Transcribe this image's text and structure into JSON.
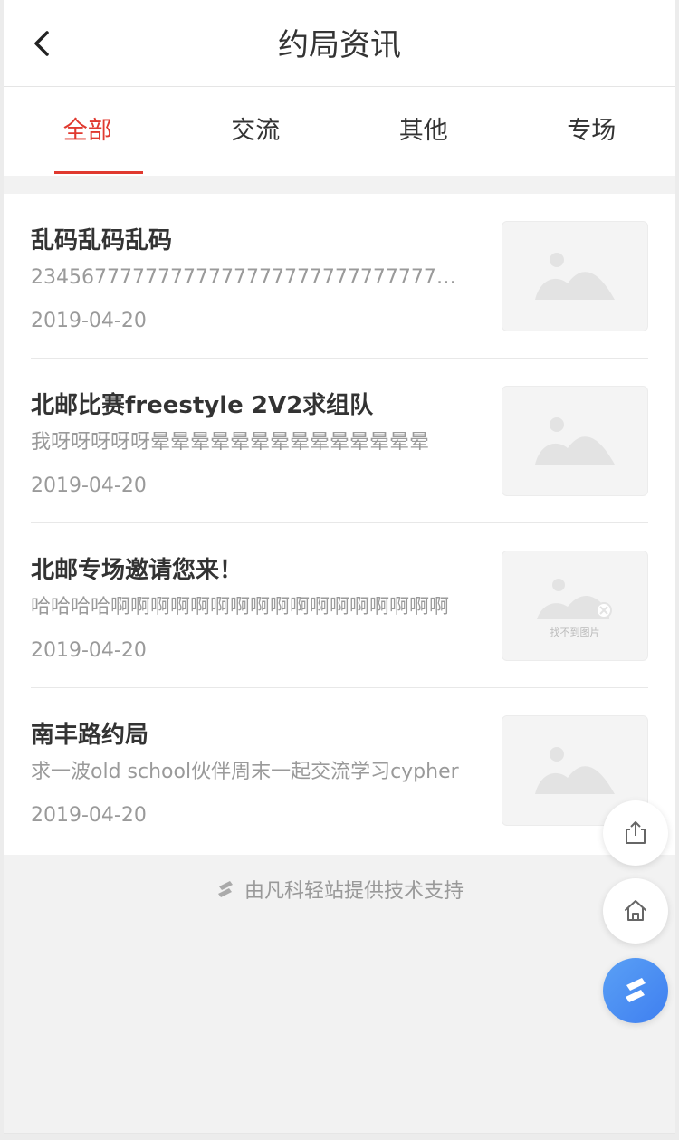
{
  "header": {
    "title": "约局资讯",
    "back_icon": "chevron-left-icon"
  },
  "tabs": [
    {
      "label": "全部",
      "active": true
    },
    {
      "label": "交流",
      "active": false
    },
    {
      "label": "其他",
      "active": false
    },
    {
      "label": "专场",
      "active": false
    }
  ],
  "articles": [
    {
      "title": "乱码乱码乱码",
      "summary": "2345677777777777777777777777777777777",
      "date": "2019-04-20",
      "thumb": "image-placeholder-icon",
      "thumb_caption": ""
    },
    {
      "title": "北邮比赛freestyle 2V2求组队",
      "summary": "我呀呀呀呀呀晕晕晕晕晕晕晕晕晕晕晕晕晕晕",
      "date": "2019-04-20",
      "thumb": "image-placeholder-icon",
      "thumb_caption": ""
    },
    {
      "title": "北邮专场邀请您来！",
      "summary": "哈哈哈哈啊啊啊啊啊啊啊啊啊啊啊啊啊啊啊啊啊",
      "date": "2019-04-20",
      "thumb": "image-not-found-icon",
      "thumb_caption": "找不到图片"
    },
    {
      "title": "南丰路约局",
      "summary": "求一波old school伙伴周末一起交流学习cypher",
      "date": "2019-04-20",
      "thumb": "image-placeholder-icon",
      "thumb_caption": ""
    }
  ],
  "footer": {
    "text": "由凡科轻站提供技术支持",
    "logo_icon": "brand-logo-icon"
  },
  "float_buttons": {
    "share_icon": "share-icon",
    "home_icon": "home-icon",
    "brand_icon": "brand-logo-icon"
  },
  "colors": {
    "accent": "#e0392f",
    "brand_blue": "#4a8df2"
  }
}
